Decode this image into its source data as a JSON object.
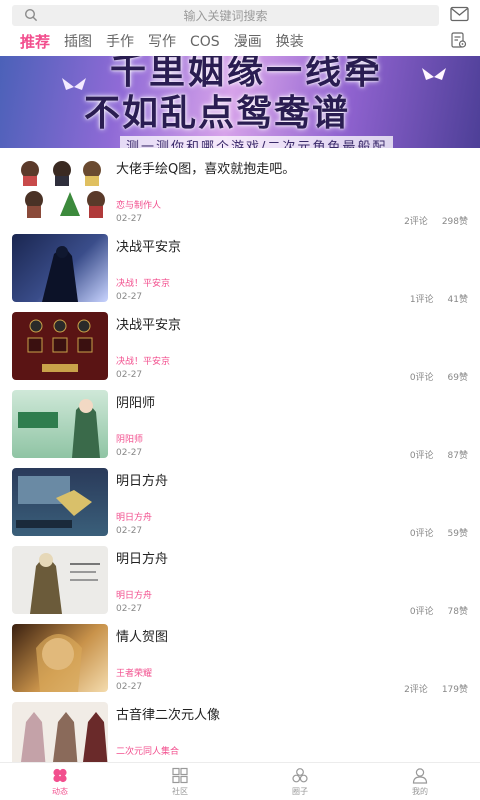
{
  "header": {
    "search_placeholder": "输入关键词搜索",
    "tabs": [
      {
        "label": "推荐"
      },
      {
        "label": "插图"
      },
      {
        "label": "手作"
      },
      {
        "label": "写作"
      },
      {
        "label": "COS"
      },
      {
        "label": "漫画"
      },
      {
        "label": "换装"
      }
    ]
  },
  "banner": {
    "line1": "千里姻缘一线牵",
    "line2": "不如乱点鸳鸯谱",
    "line3": "测一测你和哪个游戏/二次元角色最般配"
  },
  "feed": [
    {
      "title": "大佬手绘Q图，喜欢就抱走吧。",
      "tag": "恋与制作人",
      "date": "02-27",
      "comments": "2评论",
      "likes": "298赞"
    },
    {
      "title": "决战平安京",
      "tag": "决战！平安京",
      "date": "02-27",
      "comments": "1评论",
      "likes": "41赞"
    },
    {
      "title": "决战平安京",
      "tag": "决战！平安京",
      "date": "02-27",
      "comments": "0评论",
      "likes": "69赞"
    },
    {
      "title": "阴阳师",
      "tag": "阴阳师",
      "date": "02-27",
      "comments": "0评论",
      "likes": "87赞"
    },
    {
      "title": "明日方舟",
      "tag": "明日方舟",
      "date": "02-27",
      "comments": "0评论",
      "likes": "59赞"
    },
    {
      "title": "明日方舟",
      "tag": "明日方舟",
      "date": "02-27",
      "comments": "0评论",
      "likes": "78赞"
    },
    {
      "title": "情人贺图",
      "tag": "王者荣耀",
      "date": "02-27",
      "comments": "2评论",
      "likes": "179赞"
    },
    {
      "title": "古音律二次元人像",
      "tag": "二次元同人集合",
      "date": "",
      "comments": "",
      "likes": ""
    }
  ],
  "bottom_nav": [
    {
      "label": "动态"
    },
    {
      "label": "社区"
    },
    {
      "label": "圈子"
    },
    {
      "label": "我的"
    }
  ],
  "colors": {
    "accent": "#f24f8e",
    "muted": "#888888"
  }
}
